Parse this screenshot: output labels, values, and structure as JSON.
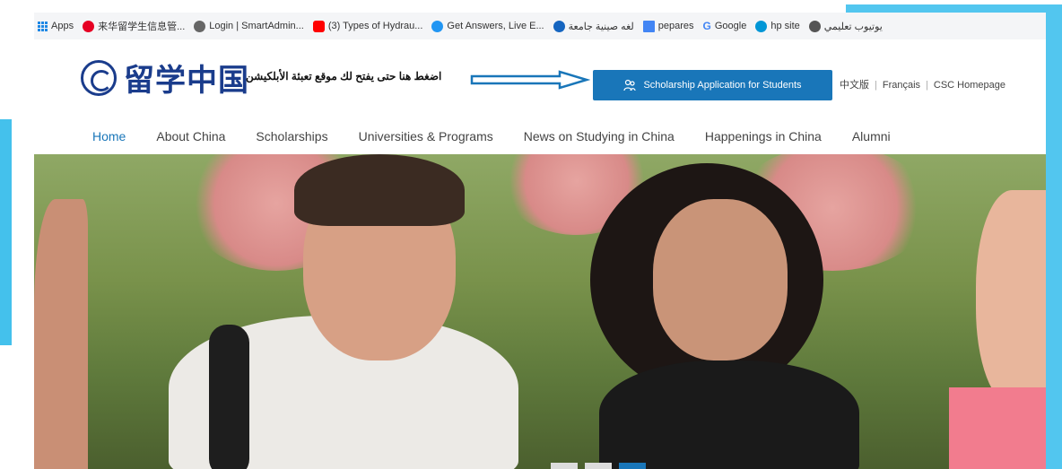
{
  "bookmarks": [
    {
      "label": "Apps",
      "icon": "apps-grid-icon"
    },
    {
      "label": "来华留学生信息管...",
      "icon": "pinterest-icon",
      "color": "#e60023"
    },
    {
      "label": "Login | SmartAdmin...",
      "icon": "globe-icon",
      "color": "#555555"
    },
    {
      "label": "(3) Types of Hydrau...",
      "icon": "youtube-icon",
      "color": "#ff0000"
    },
    {
      "label": "Get Answers, Live E...",
      "icon": "chat-icon",
      "color": "#2196f3"
    },
    {
      "label": "لغه صينية جامعة",
      "icon": "globe-icon",
      "color": "#1565c0"
    },
    {
      "label": "pepares",
      "icon": "chart-icon",
      "color": "#4285f4"
    },
    {
      "label": "Google",
      "icon": "google-icon",
      "color": "#4285f4"
    },
    {
      "label": "hp site",
      "icon": "hp-icon",
      "color": "#0096d6"
    },
    {
      "label": "يوتيوب تعليمي",
      "icon": "globe-icon",
      "color": "#555555"
    }
  ],
  "header": {
    "logo_text": "留学中国",
    "arabic_note": "اضغط هنا حتى يفتح لك موقع تعبئة الأبلكيشن",
    "apply_button": "Scholarship Application for Students",
    "lang_links": [
      "中文版",
      "Français",
      "CSC Homepage"
    ]
  },
  "nav": {
    "items": [
      "Home",
      "About China",
      "Scholarships",
      "Universities & Programs",
      "News on Studying in China",
      "Happenings in China",
      "Alumni"
    ]
  },
  "carousel": {
    "dots_count": 3,
    "active_dot": 3
  },
  "colors": {
    "accent": "#1976b9",
    "frame": "#52c6ef",
    "logo": "#1a3c8c"
  }
}
